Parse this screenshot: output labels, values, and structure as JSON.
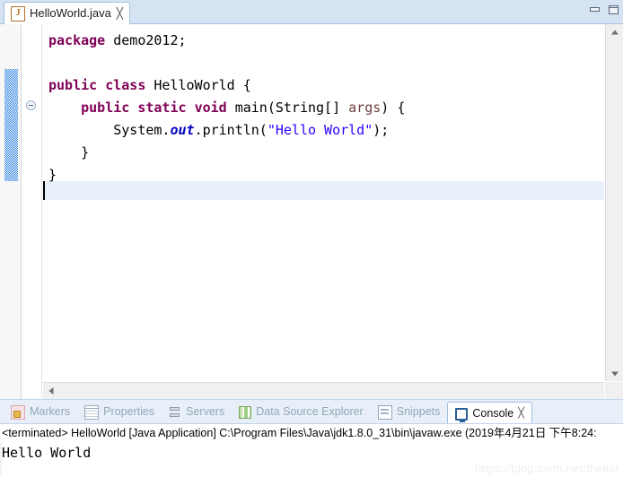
{
  "editor": {
    "tab": {
      "icon": "java-file-icon",
      "label": "HelloWorld.java",
      "close": "╳"
    },
    "window_controls": {
      "minimize": "minimize-icon",
      "maximize": "maximize-icon"
    },
    "code_lines": [
      "package demo2012;",
      "",
      "public class HelloWorld {",
      "    public static void main(String[] args) {",
      "        System.out.println(\"Hello World\");",
      "    }",
      "}",
      ""
    ],
    "language": "java",
    "fold_marker": "collapse-fold-icon",
    "scrollbars": {
      "up_arrow": "scroll-up-icon",
      "down_arrow": "scroll-down-icon",
      "left_arrow": "scroll-left-icon",
      "right_arrow": "scroll-right-icon"
    }
  },
  "view_tabs": [
    {
      "label": "Markers",
      "icon": "markers-icon",
      "active": false
    },
    {
      "label": "Properties",
      "icon": "properties-icon",
      "active": false
    },
    {
      "label": "Servers",
      "icon": "servers-icon",
      "active": false
    },
    {
      "label": "Data Source Explorer",
      "icon": "data-source-explorer-icon",
      "active": false
    },
    {
      "label": "Snippets",
      "icon": "snippets-icon",
      "active": false
    },
    {
      "label": "Console",
      "icon": "console-icon",
      "active": true,
      "close": "╳"
    }
  ],
  "console": {
    "header": "<terminated> HelloWorld [Java Application] C:\\Program Files\\Java\\jdk1.8.0_31\\bin\\javaw.exe (2019年4月21日 下午8:24:",
    "output": "Hello World"
  },
  "watermark": "https://blog.csdn.net/theliar",
  "colors": {
    "keyword": "#7f0055",
    "string": "#2a00ff",
    "field": "#0000c0",
    "parameter": "#6a3e3e",
    "tab_bar": "#d6e3f2",
    "current_line": "#e8f0fc",
    "change_bar": "#2a7fde"
  }
}
